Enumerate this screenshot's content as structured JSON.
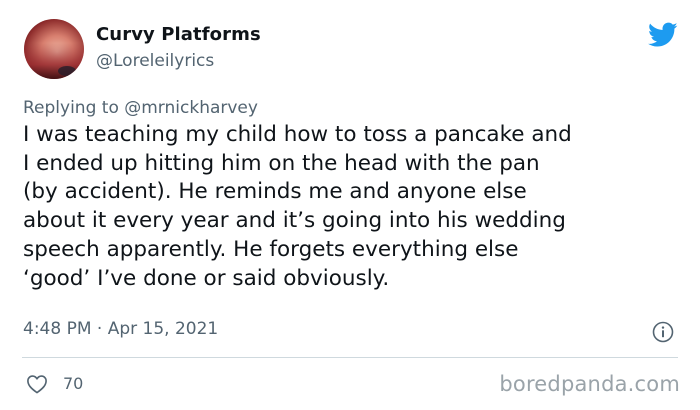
{
  "tweet": {
    "author_name": "Curvy Platforms",
    "author_handle": "@Loreleilyrics",
    "replying_prefix": "Replying to ",
    "replying_handle": "@mrnickharvey",
    "text": "I was teaching my child how to toss a pancake and\nI ended up hitting him on the head with the pan\n(by accident). He reminds me and anyone else\nabout it every year and it’s going into his wedding\nspeech apparently. He forgets everything else\n‘good’ I’ve done or said obviously.",
    "timestamp": "4:48 PM · Apr 15, 2021",
    "like_count": "70"
  },
  "icons": {
    "brand": "twitter-bird-icon",
    "info": "info-icon",
    "like": "heart-icon"
  },
  "watermark": "boredpanda.com",
  "colors": {
    "brand_blue": "#1d9bf0",
    "secondary_text": "#536471",
    "divider": "#cfd9de"
  }
}
